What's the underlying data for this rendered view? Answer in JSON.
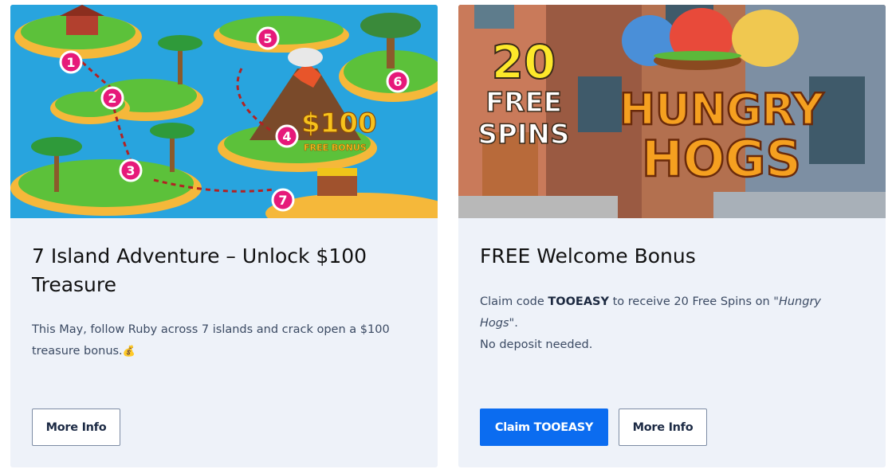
{
  "cards": [
    {
      "image_alt": "7 islands treasure map",
      "image_text": {
        "amount": "$100",
        "subtitle": "FREE BONUS",
        "markers": [
          "1",
          "2",
          "3",
          "4",
          "5",
          "6",
          "7"
        ]
      },
      "title": "7 Island Adventure – Unlock $100 Treasure",
      "description": "This May, follow Ruby across 7 islands and crack open a $100 treasure bonus.",
      "description_emoji": "💰",
      "more_info_label": "More Info"
    },
    {
      "image_alt": "Hungry Hogs slot",
      "image_text": {
        "spins_number": "20",
        "spins_line1": "FREE",
        "spins_line2": "SPINS",
        "logo_line1": "HUNGRY",
        "logo_line2": "HOGS"
      },
      "title": "FREE Welcome Bonus",
      "desc_prefix": "Claim code ",
      "desc_code": "TOOEASY",
      "desc_middle": " to receive 20 Free Spins on ",
      "desc_game": "\"Hungry Hogs\"",
      "desc_suffix": ".",
      "desc_line2": "No deposit needed.",
      "claim_label": "Claim TOOEASY",
      "more_info_label": "More Info"
    }
  ],
  "colors": {
    "card_bg": "#eef2f9",
    "primary": "#0b6cf0",
    "marker": "#e6197a",
    "sea": "#1e9bd8"
  }
}
